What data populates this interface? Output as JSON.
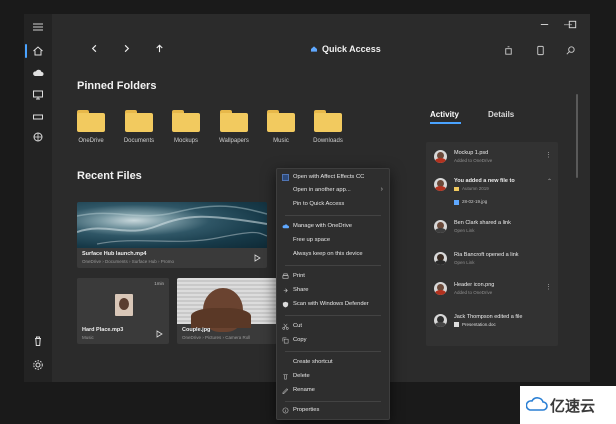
{
  "window": {
    "title": "Quick Access",
    "controls": {
      "minimize": "—",
      "maximize": "□",
      "close": "✕"
    }
  },
  "rail": {
    "icons": [
      "hamburger-icon",
      "home-icon",
      "cloud-icon",
      "desktop-icon",
      "drive-icon",
      "network-icon",
      "trash-icon",
      "settings-icon"
    ]
  },
  "pinned": {
    "heading": "Pinned Folders",
    "folders": [
      "OneDrive",
      "Documents",
      "Mockups",
      "Wallpapers",
      "Music",
      "Downloads"
    ]
  },
  "recent": {
    "heading": "Recent Files",
    "files": [
      {
        "name": "Surface Hub launch.mp4",
        "path": "OneDrive › Documents › Surface Hub › Promo"
      },
      {
        "name": "Hard Place.mp3",
        "path": "Music",
        "badge": "1min"
      },
      {
        "name": "Couple.jpg",
        "path": "OneDrive › Pictures › Camera Roll"
      }
    ]
  },
  "context_menu": {
    "items": [
      {
        "label": "Open with Affect Effects CC",
        "icon": "app-icon"
      },
      {
        "label": "Open in another app...",
        "arrow": "›"
      },
      {
        "label": "Pin to Quick Access"
      },
      {
        "label": "Manage with OneDrive",
        "icon": "cloud-icon"
      },
      {
        "label": "Free up space"
      },
      {
        "label": "Always keep on this device"
      },
      {
        "label": "Print",
        "icon": "print-icon"
      },
      {
        "label": "Share",
        "icon": "share-icon"
      },
      {
        "label": "Scan with Windows Defender",
        "icon": "shield-icon"
      },
      {
        "label": "Cut",
        "icon": "cut-icon"
      },
      {
        "label": "Copy",
        "icon": "copy-icon"
      },
      {
        "label": "Create shortcut"
      },
      {
        "label": "Delete",
        "icon": "delete-icon"
      },
      {
        "label": "Rename",
        "icon": "rename-icon"
      },
      {
        "label": "Properties",
        "icon": "properties-icon"
      }
    ]
  },
  "sidepanel": {
    "tab_activity": "Activity",
    "tab_details": "Details",
    "items": [
      {
        "title": "Mockup 1.psd",
        "sub": "Added to OneDrive"
      },
      {
        "title": "You added a new file to",
        "sub": "Autumn 2019",
        "extra": "28-02-19.jpg"
      },
      {
        "title": "Ben Clark shared a link",
        "sub": "Open Link"
      },
      {
        "title": "Ria Bancroft opened a link",
        "sub": "Open Link"
      },
      {
        "title": "Header icon.png",
        "sub": "Added to OneDrive"
      },
      {
        "title": "Jack Thompson edited a file",
        "sub": "Presentation.doc"
      }
    ]
  },
  "watermark": {
    "text": "亿速云"
  },
  "colors": {
    "accent": "#4aa3ff",
    "folder": "#f2ca5f",
    "bg": "#2b2b2b"
  }
}
